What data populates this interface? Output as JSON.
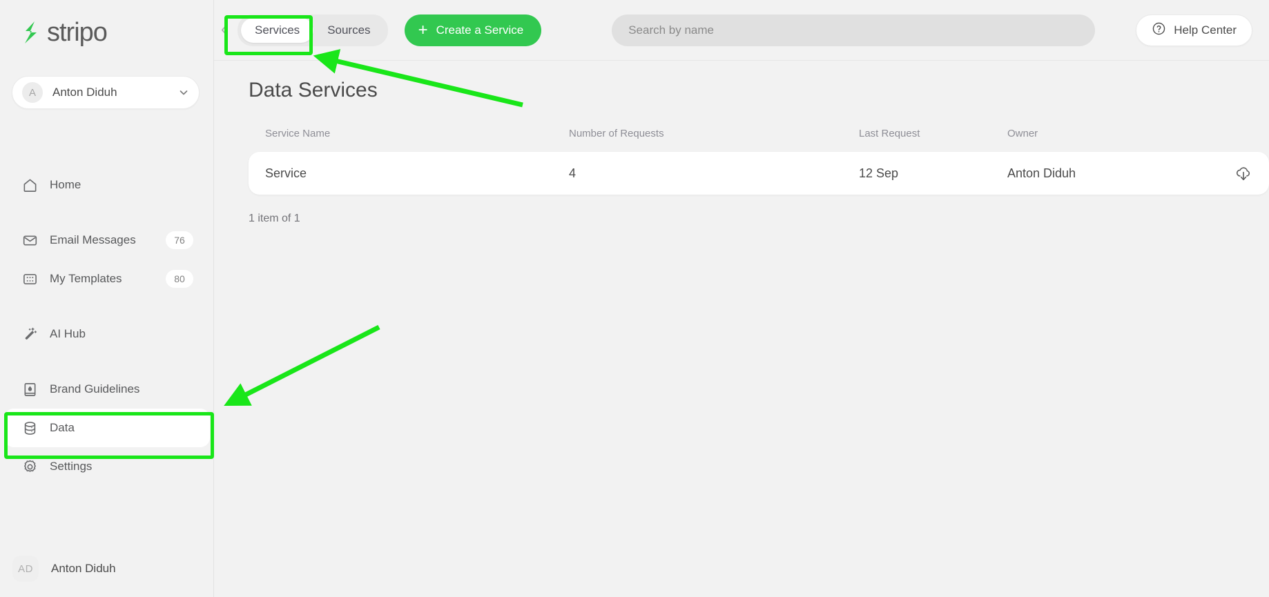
{
  "brand": {
    "name": "stripo",
    "accent": "#32c850",
    "annotation_color": "#19e619"
  },
  "sidebar": {
    "account": {
      "initial": "A",
      "name": "Anton Diduh",
      "chevron_icon": "chevron-down-icon"
    },
    "groups": [
      {
        "items": [
          {
            "icon": "home-icon",
            "label": "Home",
            "badge": "",
            "active": false
          }
        ]
      },
      {
        "items": [
          {
            "icon": "envelope-icon",
            "label": "Email Messages",
            "badge": "76",
            "active": false
          },
          {
            "icon": "templates-grid-icon",
            "label": "My Templates",
            "badge": "80",
            "active": false
          }
        ]
      },
      {
        "items": [
          {
            "icon": "magic-wand-icon",
            "label": "AI Hub",
            "badge": "",
            "active": false
          }
        ]
      },
      {
        "items": [
          {
            "icon": "book-brand-icon",
            "label": "Brand Guidelines",
            "badge": "",
            "active": false
          },
          {
            "icon": "database-icon",
            "label": "Data",
            "badge": "",
            "active": true
          },
          {
            "icon": "gear-icon",
            "label": "Settings",
            "badge": "",
            "active": false
          }
        ]
      }
    ],
    "user": {
      "initials": "AD",
      "name": "Anton Diduh"
    }
  },
  "topbar": {
    "collapse_icon": "chevron-left-icon",
    "tabs": [
      {
        "label": "Services",
        "active": true
      },
      {
        "label": "Sources",
        "active": false
      }
    ],
    "create_button": {
      "label": "Create a Service",
      "icon": "plus-icon"
    },
    "search": {
      "value": "",
      "placeholder": "Search by name",
      "icon": "search-input"
    },
    "help": {
      "label": "Help Center",
      "icon": "question-circle-icon"
    }
  },
  "main": {
    "title": "Data Services",
    "columns": [
      "Service Name",
      "Number of Requests",
      "Last Request",
      "Owner"
    ],
    "rows": [
      {
        "service_name": "Service",
        "number_of_requests": "4",
        "last_request": "12 Sep",
        "owner": "Anton Diduh",
        "action_icon": "cloud-download-icon"
      }
    ],
    "item_count": "1 item of 1"
  }
}
